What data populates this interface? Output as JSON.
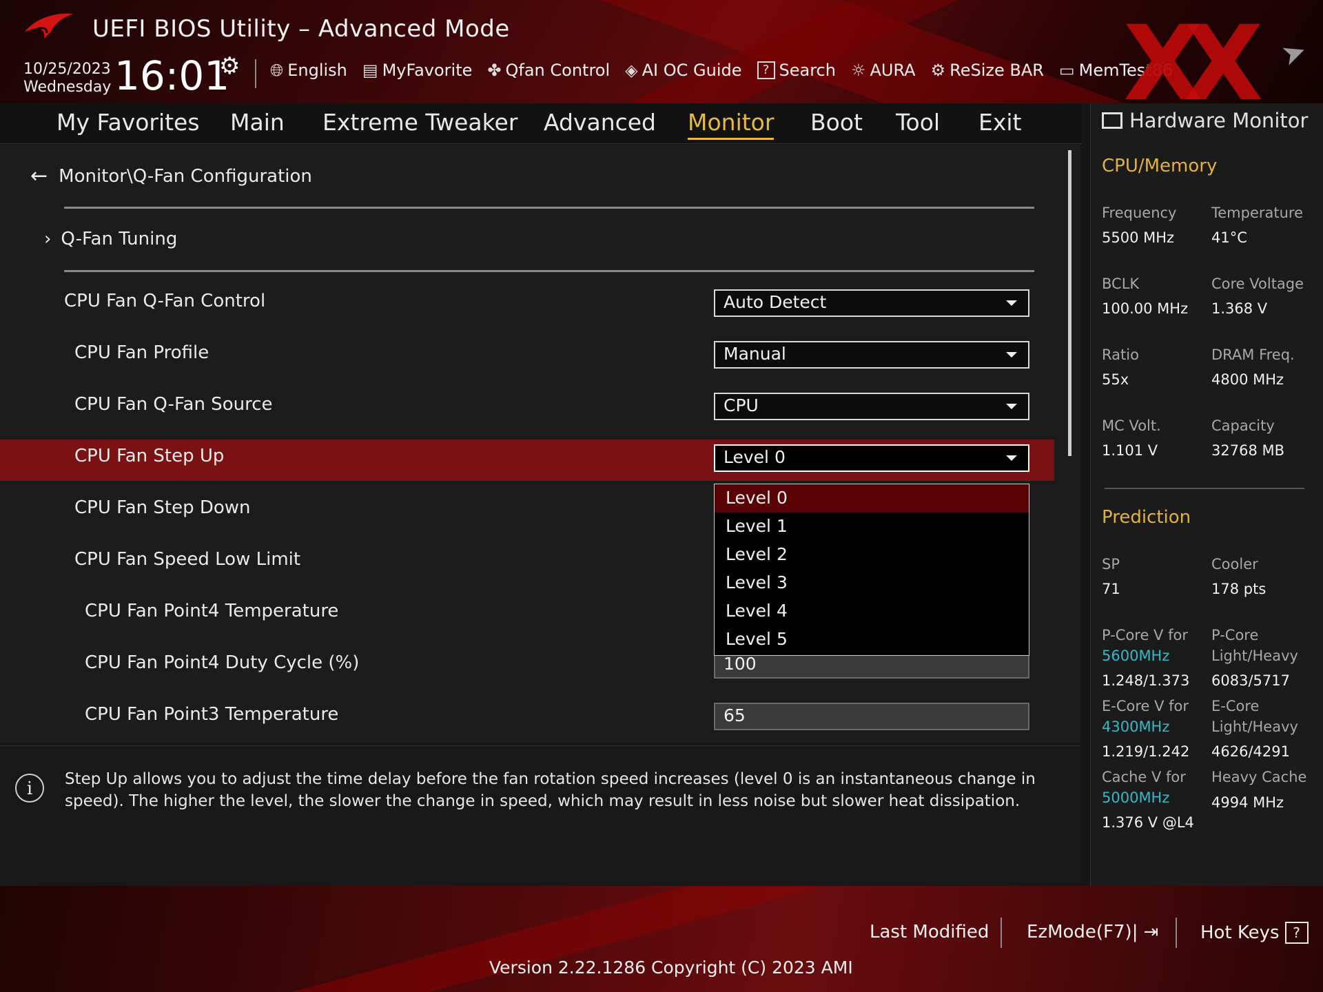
{
  "header": {
    "title": "UEFI BIOS Utility – Advanced Mode",
    "date": "10/25/2023",
    "weekday": "Wednesday",
    "time": "16:01",
    "toolbar": [
      {
        "icon": "globe-icon",
        "label": "English"
      },
      {
        "icon": "favorite-list-icon",
        "label": "MyFavorite"
      },
      {
        "icon": "fan-icon",
        "label": "Qfan Control"
      },
      {
        "icon": "ai-chip-icon",
        "label": "AI OC Guide"
      },
      {
        "icon": "question-box-icon",
        "label": "Search"
      },
      {
        "icon": "aura-light-icon",
        "label": "AURA"
      },
      {
        "icon": "resize-bar-icon",
        "label": "ReSize BAR"
      },
      {
        "icon": "memory-icon",
        "label": "MemTes",
        "label_faded": "t86"
      }
    ]
  },
  "nav": {
    "tabs": [
      "My Favorites",
      "Main",
      "Extreme Tweaker",
      "Advanced",
      "Monitor",
      "Boot",
      "Tool",
      "Exit"
    ],
    "active": "Monitor"
  },
  "main": {
    "breadcrumb": "Monitor\\Q-Fan Configuration",
    "submenu": "Q-Fan Tuning",
    "rows": [
      {
        "label": "CPU Fan Q-Fan Control",
        "value": "Auto Detect"
      },
      {
        "label": "CPU Fan Profile",
        "value": "Manual"
      },
      {
        "label": "CPU Fan Q-Fan Source",
        "value": "CPU"
      },
      {
        "label": "CPU Fan Step Up",
        "value": "Level 0"
      },
      {
        "label": "CPU Fan Step Down",
        "value": ""
      },
      {
        "label": "CPU Fan Speed Low Limit",
        "value": ""
      },
      {
        "label": "CPU Fan Point4 Temperature",
        "value": ""
      },
      {
        "label": "CPU Fan Point4 Duty Cycle (%)",
        "value": "100"
      },
      {
        "label": "CPU Fan Point3 Temperature",
        "value": "65"
      }
    ],
    "dropdown_options": [
      "Level 0",
      "Level 1",
      "Level 2",
      "Level 3",
      "Level 4",
      "Level 5"
    ],
    "dropdown_selected": "Level 0"
  },
  "help": {
    "text": "Step Up allows you to adjust the time delay before the fan rotation speed increases (level 0 is an instantaneous change in speed). The higher the level, the slower the change in speed, which may result in less noise but slower heat dissipation."
  },
  "hw_monitor": {
    "title": "Hardware Monitor",
    "cpu_memory": {
      "heading": "CPU/Memory",
      "frequency_label": "Frequency",
      "frequency": "5500 MHz",
      "temperature_label": "Temperature",
      "temperature": "41°C",
      "bclk_label": "BCLK",
      "bclk": "100.00 MHz",
      "core_voltage_label": "Core Voltage",
      "core_voltage": "1.368 V",
      "ratio_label": "Ratio",
      "ratio": "55x",
      "dram_label": "DRAM Freq.",
      "dram": "4800 MHz",
      "mc_volt_label": "MC Volt.",
      "mc_volt": "1.101 V",
      "capacity_label": "Capacity",
      "capacity": "32768 MB"
    },
    "prediction": {
      "heading": "Prediction",
      "sp_label": "SP",
      "sp": "71",
      "cooler_label": "Cooler",
      "cooler": "178 pts",
      "pcore_v_label": "P-Core V for",
      "pcore_v_freq": "5600MHz",
      "pcore_v": "1.248/1.373",
      "pcore_lh_label_1": "P-Core",
      "pcore_lh_label_2": "Light/Heavy",
      "pcore_lh": "6083/5717",
      "ecore_v_label": "E-Core V for",
      "ecore_v_freq": "4300MHz",
      "ecore_v": "1.219/1.242",
      "ecore_lh_label_1": "E-Core",
      "ecore_lh_label_2": "Light/Heavy",
      "ecore_lh": "4626/4291",
      "cache_v_label": "Cache V for",
      "cache_v_freq": "5000MHz",
      "cache_v": "1.376 V @L4",
      "heavy_cache_label": "Heavy Cache",
      "heavy_cache": "4994 MHz"
    }
  },
  "footer": {
    "last_modified": "Last Modified",
    "ezmode": "EzMode(F7)|",
    "hotkeys": "Hot Keys",
    "hotkeys_key": "?",
    "version": "Version 2.22.1286 Copyright (C) 2023 AMI"
  },
  "colors": {
    "accent_gold": "#e7b93c",
    "highlight_red": "#7a1214",
    "selected_option": "#5a0306",
    "cyan_value": "#35b9c8"
  }
}
